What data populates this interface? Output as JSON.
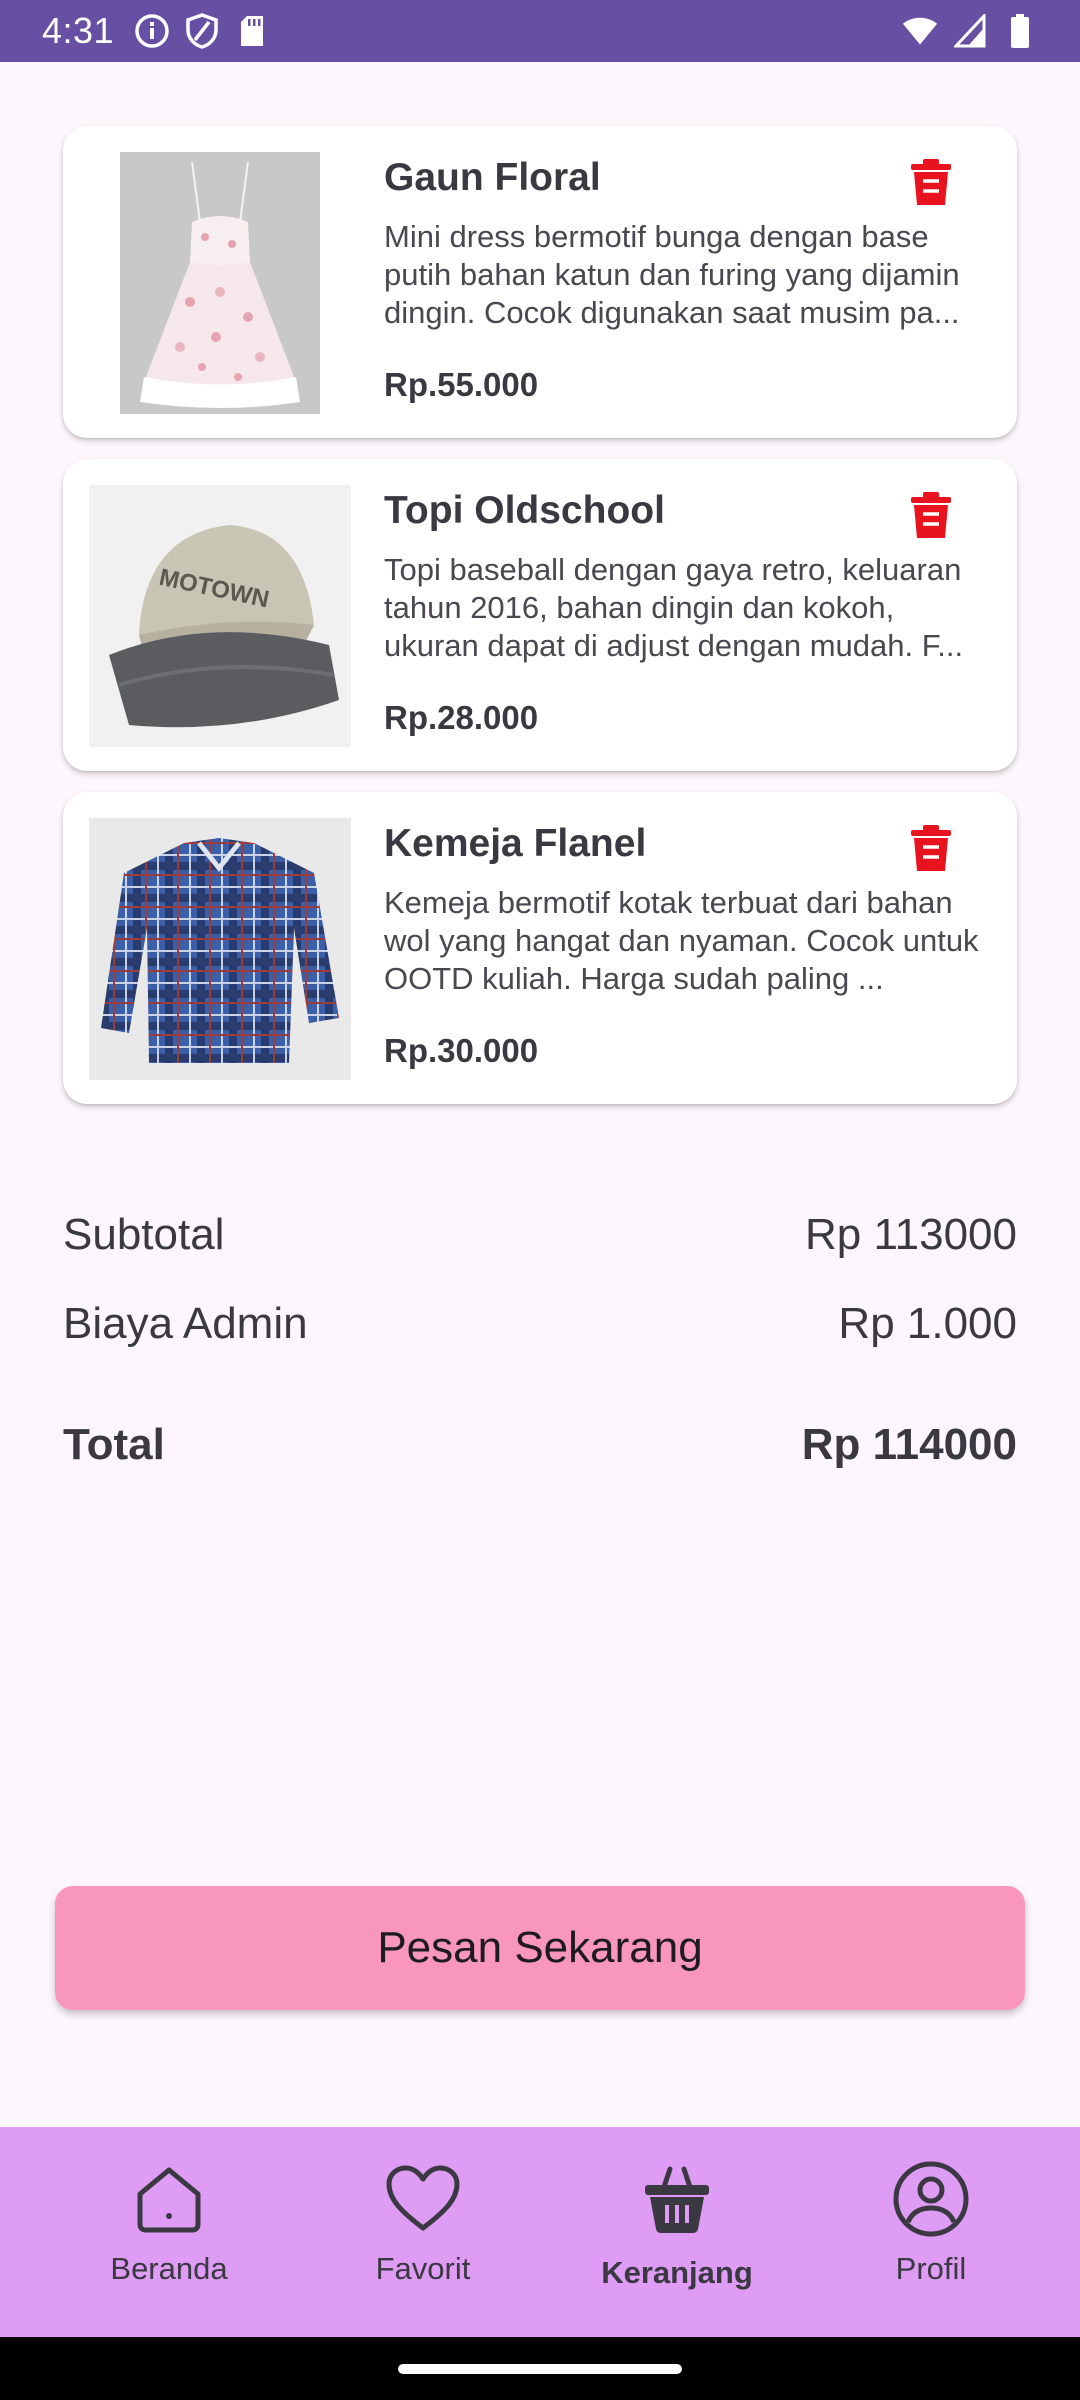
{
  "status_bar": {
    "time": "4:31",
    "left_icons": [
      "info-icon",
      "shield-icon",
      "sd-card-icon"
    ],
    "right_icons": [
      "wifi-icon",
      "signal-icon",
      "battery-icon"
    ]
  },
  "cart": {
    "items": [
      {
        "name": "Gaun Floral",
        "description": "Mini dress bermotif bunga dengan base putih bahan katun dan furing yang dijamin dingin. Cocok digunakan saat musim pa...",
        "price": "Rp.55.000",
        "image": "floral-dress-photo"
      },
      {
        "name": "Topi Oldschool",
        "description": "Topi baseball dengan gaya retro, keluaran tahun 2016, bahan dingin dan kokoh, ukuran dapat di adjust dengan mudah. F...",
        "price": "Rp.28.000",
        "image": "baseball-cap-photo"
      },
      {
        "name": "Kemeja Flanel",
        "description": "Kemeja bermotif kotak terbuat dari bahan wol yang hangat dan nyaman. Cocok untuk OOTD kuliah. Harga sudah paling ...",
        "price": "Rp.30.000",
        "image": "flannel-shirt-photo"
      }
    ]
  },
  "summary": {
    "subtotal_label": "Subtotal",
    "subtotal_value": "Rp 113000",
    "admin_label": "Biaya Admin",
    "admin_value": "Rp 1.000",
    "total_label": "Total",
    "total_value": "Rp 114000"
  },
  "order_button_label": "Pesan Sekarang",
  "bottom_nav": {
    "items": [
      {
        "label": "Beranda",
        "icon": "home-icon",
        "active": false
      },
      {
        "label": "Favorit",
        "icon": "heart-icon",
        "active": false
      },
      {
        "label": "Keranjang",
        "icon": "basket-icon",
        "active": true
      },
      {
        "label": "Profil",
        "icon": "profile-icon",
        "active": false
      }
    ]
  },
  "colors": {
    "status_bar": "#6750a4",
    "background": "#fdf6fc",
    "delete_icon": "#e8131f",
    "order_button": "#f896bd",
    "bottom_nav": "#de9cf5"
  }
}
